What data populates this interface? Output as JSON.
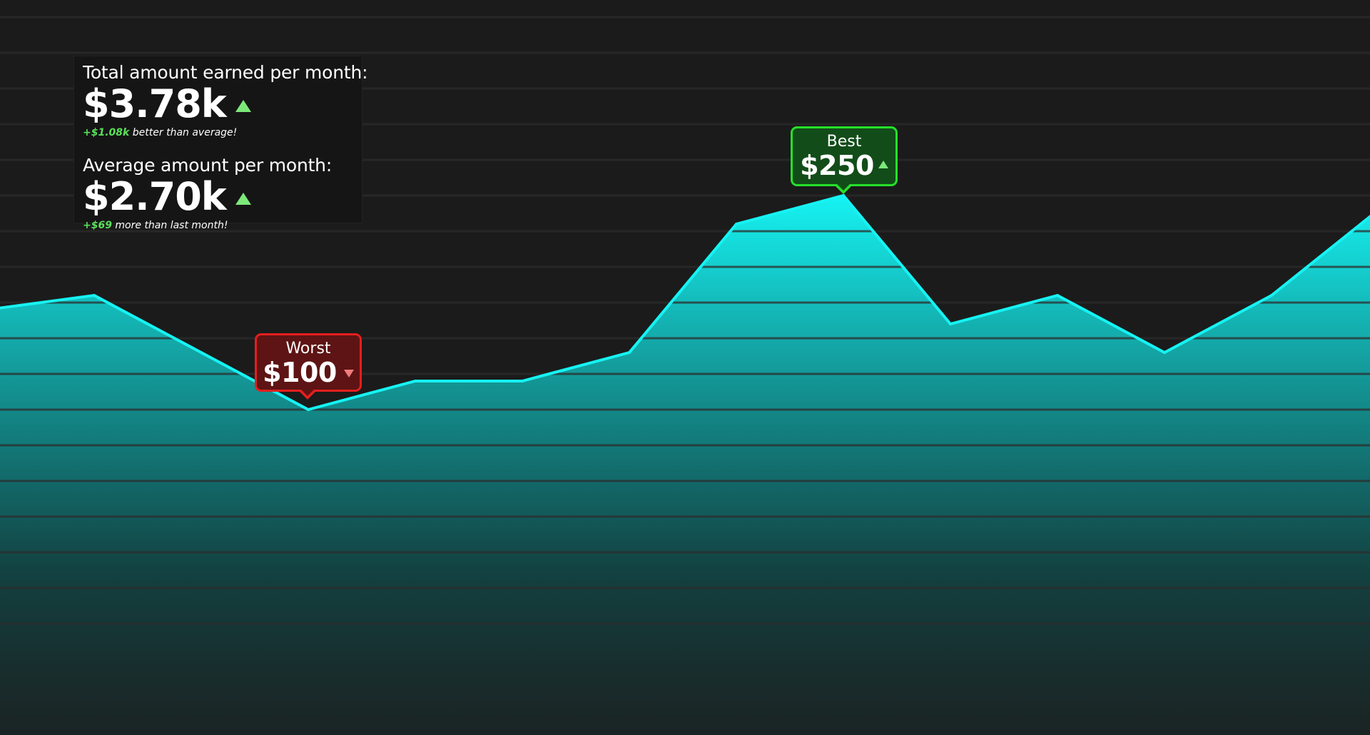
{
  "summary": {
    "total": {
      "label": "Total amount earned per month:",
      "value": "$3.78k",
      "note_delta": "+$1.08k",
      "note_text": " better than average!"
    },
    "average": {
      "label": "Average amount per month:",
      "value": "$2.70k",
      "note_delta": "+$69",
      "note_text": " more than last month!"
    }
  },
  "callouts": {
    "worst": {
      "label": "Worst",
      "value": "$100"
    },
    "best": {
      "label": "Best",
      "value": "$250"
    }
  },
  "colors": {
    "background": "#1b1b1b",
    "gridline": "#2c2c2c",
    "line": "#16f3f3",
    "positive": "#7de87a",
    "negative": "#f07c7c",
    "worst_fill": "#5e1414",
    "worst_border": "#e41f1f",
    "best_fill": "#124d19",
    "best_border": "#26e02a"
  },
  "chart_data": {
    "type": "area",
    "x": [
      0,
      1,
      2,
      3,
      4,
      5,
      6,
      7,
      8,
      9,
      10,
      11,
      12,
      13
    ],
    "series": [
      {
        "values": [
          170,
          180,
          140,
          100,
          120,
          120,
          140,
          230,
          250,
          160,
          180,
          140,
          180,
          240
        ]
      }
    ],
    "ylim": [
      -50,
      400
    ],
    "grid": true,
    "legend": "none"
  }
}
